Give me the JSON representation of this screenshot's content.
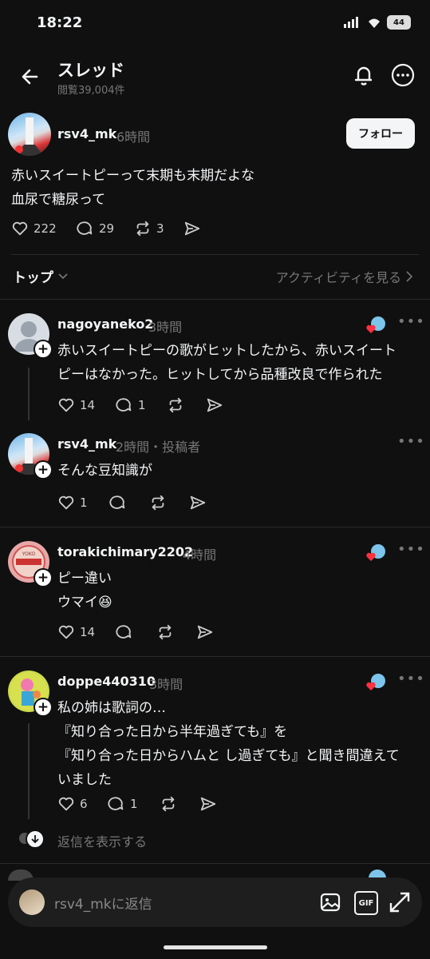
{
  "status_bar": {
    "time": "18:22",
    "battery": "44"
  },
  "header": {
    "title": "スレッド",
    "views": "閲覧39,004件"
  },
  "main_post": {
    "username": "rsv4_mk",
    "time": "6時間",
    "follow_label": "フォロー",
    "lines": [
      "赤いスイートピーって末期も末期だよな",
      "血尿で糖尿って"
    ],
    "likes": "222",
    "comments": "29",
    "reposts": "3"
  },
  "sort": {
    "label": "トップ",
    "activity": "アクティビティを見る"
  },
  "replies": [
    {
      "username": "nagoyaneko2",
      "time": "3時間",
      "lines": [
        "赤いスイートピーの歌がヒットしたから、赤いスイート",
        "ピーはなかった。ヒットしてから品種改良で作られた"
      ],
      "likes": "14",
      "comments": "1"
    },
    {
      "username": "rsv4_mk",
      "time": "2時間・投稿者",
      "lines": [
        "そんな豆知識が"
      ],
      "likes": "1",
      "comments": ""
    },
    {
      "username": "torakichimary2202",
      "time": "4時間",
      "lines": [
        "ピー違い",
        "ウマイ😆"
      ],
      "likes": "14",
      "comments": ""
    },
    {
      "username": "doppe440310",
      "time": "3時間",
      "lines": [
        "私の姉は歌詞の…",
        "『知り合った日から半年過ぎても』を",
        "『知り合った日からハムと し過ぎても』と聞き間違えて",
        "いました"
      ],
      "likes": "6",
      "comments": "1"
    }
  ],
  "show_replies": "返信を表示する",
  "reply_bar": {
    "placeholder": "rsv4_mkに返信",
    "gif_label": "GIF"
  },
  "colors": {
    "background": "#101010",
    "text": "#f3f5f7",
    "muted": "#777777",
    "like_red": "#ff3040"
  }
}
